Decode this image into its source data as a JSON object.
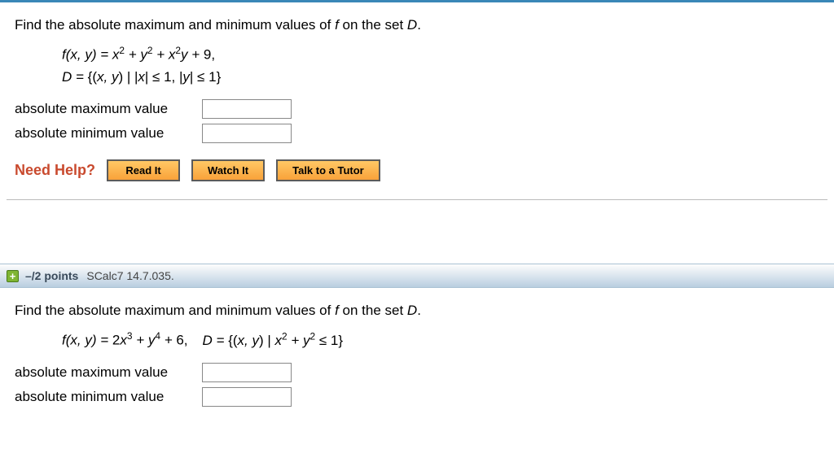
{
  "q1": {
    "prompt_prefix": "Find the absolute maximum and minimum values of ",
    "prompt_f": "f",
    "prompt_mid": " on the set ",
    "prompt_D": "D",
    "prompt_suffix": ".",
    "formula_line1_html": "f(x, y) = x<sup>2</sup> + y<sup>2</sup> + x<sup>2</sup>y + <span class='upright'>9,</span>",
    "formula_line2_html": "D = <span class='upright'>{(</span>x, y<span class='upright'>) | |</span>x<span class='upright'>| ≤ 1, |</span>y<span class='upright'>| ≤ 1}</span>",
    "max_label": "absolute maximum value",
    "min_label": "absolute minimum value",
    "max_value": "",
    "min_value": "",
    "help_label": "Need Help?",
    "btn_read": "Read It",
    "btn_watch": "Watch It",
    "btn_tutor": "Talk to a Tutor"
  },
  "header": {
    "points": "–/2 points",
    "reference": "SCalc7 14.7.035."
  },
  "q2": {
    "prompt_prefix": "Find the absolute maximum and minimum values of ",
    "prompt_f": "f",
    "prompt_mid": " on the set ",
    "prompt_D": "D",
    "prompt_suffix": ".",
    "formula_html": "f(x, y) = <span class='upright'>2</span>x<sup>3</sup> + y<sup>4</sup> + <span class='upright'>6,</span><span class='inline-set'>D = <span class='upright'>{(</span>x, y<span class='upright'>) | </span>x<sup>2</sup> + y<sup>2</sup> <span class='upright'>≤ 1}</span></span>",
    "max_label": "absolute maximum value",
    "min_label": "absolute minimum value",
    "max_value": "",
    "min_value": ""
  }
}
